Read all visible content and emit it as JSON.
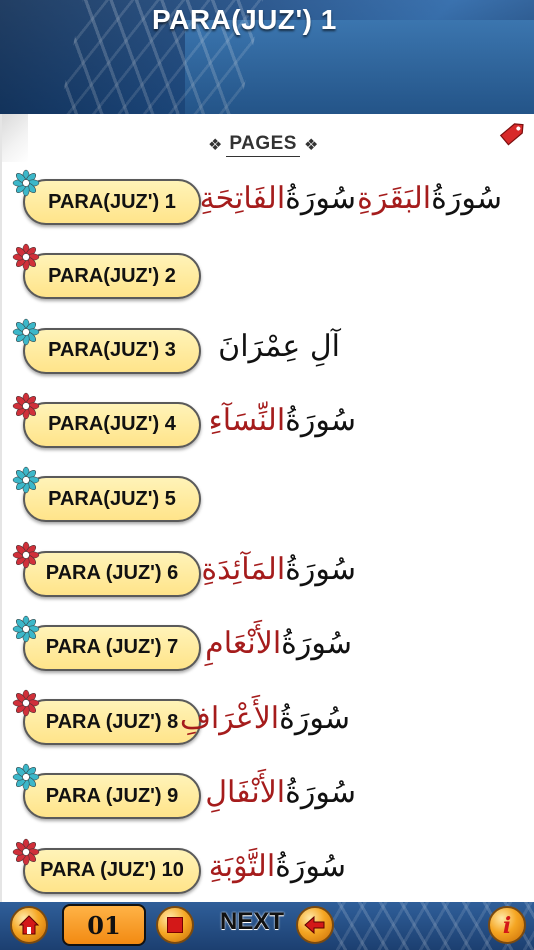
{
  "header": {
    "title": "PARA(JUZ') 1"
  },
  "pages_title": "PAGES",
  "icons": {
    "tag": "tag-icon",
    "flower": "flower-icon"
  },
  "colors": {
    "pill": "#ffe48a",
    "arabic_red": "#a51c1c",
    "flower_teal": "#3cb7c9",
    "flower_red": "#d0303a"
  },
  "paras": [
    {
      "label": "PARA(JUZ') 1",
      "flower": "teal",
      "surahs": [
        {
          "w1": "سُورَةُ",
          "w2": "الفَاتِحَةِ"
        },
        {
          "w1": "سُورَةُ",
          "w2": "البَقَرَةِ"
        }
      ]
    },
    {
      "label": "PARA(JUZ') 2",
      "flower": "red",
      "surahs": []
    },
    {
      "label": "PARA(JUZ') 3",
      "flower": "teal",
      "surahs": [
        {
          "w1": "آلِ عِمْرَانَ",
          "w2": ""
        }
      ]
    },
    {
      "label": "PARA(JUZ') 4",
      "flower": "red",
      "surahs": [
        {
          "w1": "سُورَةُ",
          "w2": "النِّسَآءِ"
        }
      ]
    },
    {
      "label": "PARA(JUZ') 5",
      "flower": "teal",
      "surahs": []
    },
    {
      "label": "PARA (JUZ') 6",
      "flower": "red",
      "surahs": [
        {
          "w1": "سُورَةُ",
          "w2": "المَآئِدَةِ"
        }
      ]
    },
    {
      "label": "PARA (JUZ') 7",
      "flower": "teal",
      "surahs": [
        {
          "w1": "سُورَةُ",
          "w2": "الأَنْعَامِ"
        }
      ]
    },
    {
      "label": "PARA (JUZ') 8",
      "flower": "red",
      "surahs": [
        {
          "w1": "سُورَةُ",
          "w2": "الأَعْرَافِ"
        }
      ]
    },
    {
      "label": "PARA (JUZ') 9",
      "flower": "teal",
      "surahs": [
        {
          "w1": "سُورَةُ",
          "w2": "الأَنْفَالِ"
        }
      ]
    },
    {
      "label": "PARA (JUZ') 10",
      "flower": "red",
      "surahs": [
        {
          "w1": "سُورَةُ",
          "w2": "التَّوْبَةِ"
        }
      ]
    }
  ],
  "bottom": {
    "page_number": "01",
    "next_label": "NEXT",
    "home_icon": "home-icon",
    "stop_icon": "stop-icon",
    "next_icon": "arrow-left-icon",
    "info_icon": "info-icon"
  }
}
